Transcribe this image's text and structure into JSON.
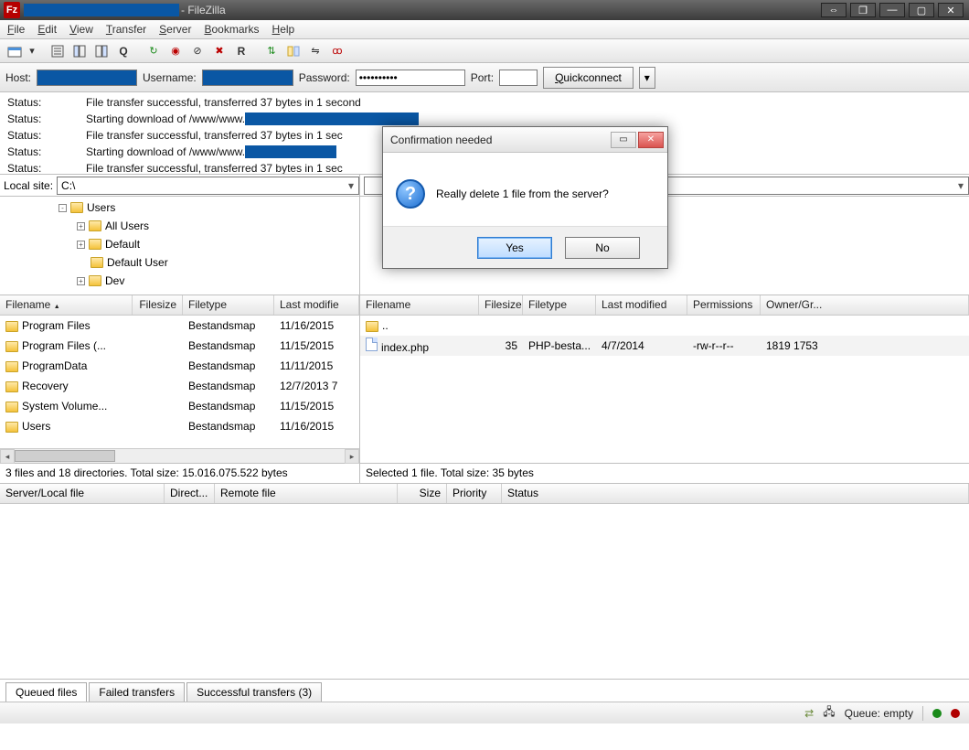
{
  "titlebar": {
    "app": " - FileZilla"
  },
  "menu": {
    "file": "File",
    "edit": "Edit",
    "view": "View",
    "transfer": "Transfer",
    "server": "Server",
    "bookmarks": "Bookmarks",
    "help": "Help"
  },
  "quickconnect": {
    "host_label": "Host:",
    "user_label": "Username:",
    "pass_label": "Password:",
    "pass_value": "••••••••••",
    "port_label": "Port:",
    "port_value": "",
    "button": "uickconnect",
    "button_prefix": "Q"
  },
  "status": {
    "label": "Status:",
    "lines": [
      "File transfer successful, transferred 37 bytes in 1 second",
      "Starting download of /www/www.",
      "File transfer successful, transferred 37 bytes in 1 sec",
      "Starting download of /www/www.",
      "File transfer successful, transferred 37 bytes in 1 sec"
    ]
  },
  "local": {
    "label": "Local site:",
    "path": "C:\\",
    "tree": [
      {
        "indent": 0,
        "pm": "-",
        "name": "Users"
      },
      {
        "indent": 1,
        "pm": "+",
        "name": "All Users"
      },
      {
        "indent": 1,
        "pm": "+",
        "name": "Default"
      },
      {
        "indent": 1,
        "pm": "",
        "name": "Default User"
      },
      {
        "indent": 1,
        "pm": "+",
        "name": "Dev"
      }
    ],
    "cols": {
      "name": "Filename",
      "size": "Filesize",
      "type": "Filetype",
      "mod": "Last modifie"
    },
    "rows": [
      {
        "name": "Program Files",
        "type": "Bestandsmap",
        "mod": "11/16/2015"
      },
      {
        "name": "Program Files (...",
        "type": "Bestandsmap",
        "mod": "11/15/2015"
      },
      {
        "name": "ProgramData",
        "type": "Bestandsmap",
        "mod": "11/11/2015"
      },
      {
        "name": "Recovery",
        "type": "Bestandsmap",
        "mod": "12/7/2013 7"
      },
      {
        "name": "System Volume...",
        "type": "Bestandsmap",
        "mod": "11/15/2015"
      },
      {
        "name": "Users",
        "type": "Bestandsmap",
        "mod": "11/16/2015"
      }
    ],
    "strip": "3 files and 18 directories. Total size: 15.016.075.522 bytes"
  },
  "remote": {
    "cols": {
      "name": "Filename",
      "size": "Filesize",
      "type": "Filetype",
      "mod": "Last modified",
      "perm": "Permissions",
      "own": "Owner/Gr..."
    },
    "rows": [
      {
        "name": "..",
        "size": "",
        "type": "",
        "mod": "",
        "perm": "",
        "own": ""
      },
      {
        "name": "index.php",
        "size": "35",
        "type": "PHP-besta...",
        "mod": "4/7/2014",
        "perm": "-rw-r--r--",
        "own": "1819 1753"
      }
    ],
    "strip": "Selected 1 file. Total size: 35 bytes"
  },
  "queue": {
    "cols": {
      "srv": "Server/Local file",
      "dir": "Direct...",
      "rf": "Remote file",
      "size": "Size",
      "prio": "Priority",
      "stat": "Status"
    },
    "tabs": {
      "q": "Queued files",
      "f": "Failed transfers",
      "s": "Successful transfers (3)"
    }
  },
  "statusbar": {
    "queue": "Queue: empty"
  },
  "dialog": {
    "title": "Confirmation needed",
    "msg": "Really delete 1 file from the server?",
    "yes": "Yes",
    "no": "No"
  }
}
